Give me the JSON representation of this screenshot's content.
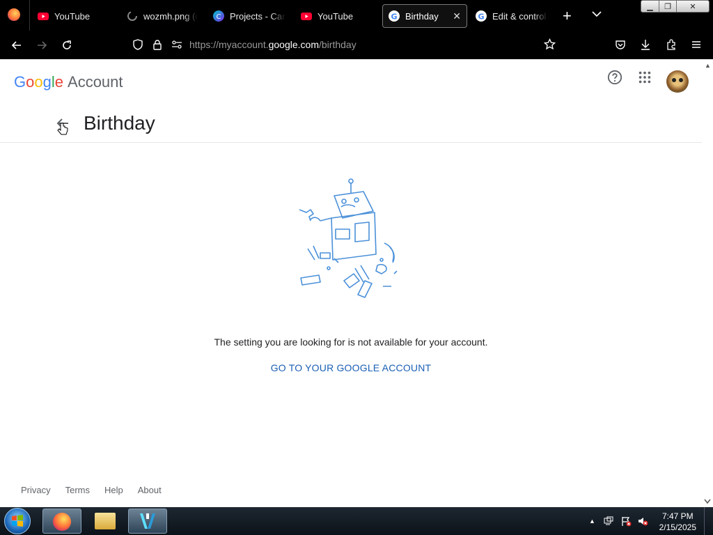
{
  "browser": {
    "tabs": [
      {
        "title": "YouTube",
        "icon": "youtube-icon"
      },
      {
        "title": "wozmh.png (of",
        "icon": "loading-icon"
      },
      {
        "title": "Projects - Canv",
        "icon": "canva-icon"
      },
      {
        "title": "YouTube",
        "icon": "youtube-icon"
      },
      {
        "title": "Birthday",
        "icon": "google-icon",
        "active": true
      },
      {
        "title": "Edit & control",
        "icon": "google-icon"
      }
    ],
    "url_prefix": "https://myaccount.",
    "url_domain": "google.com",
    "url_path": "/birthday"
  },
  "account": {
    "logo_letters": [
      "G",
      "o",
      "o",
      "g",
      "l",
      "e"
    ],
    "logo_colors": [
      "#4285F4",
      "#EA4335",
      "#FBBC05",
      "#4285F4",
      "#34A853",
      "#EA4335"
    ],
    "account_label": "Account",
    "page_title": "Birthday",
    "message": "The setting you are looking for is not available for your account.",
    "link_text": "GO TO YOUR GOOGLE ACCOUNT",
    "footer": [
      "Privacy",
      "Terms",
      "Help",
      "About"
    ]
  },
  "taskbar": {
    "time": "7:47 PM",
    "date": "2/15/2025"
  }
}
